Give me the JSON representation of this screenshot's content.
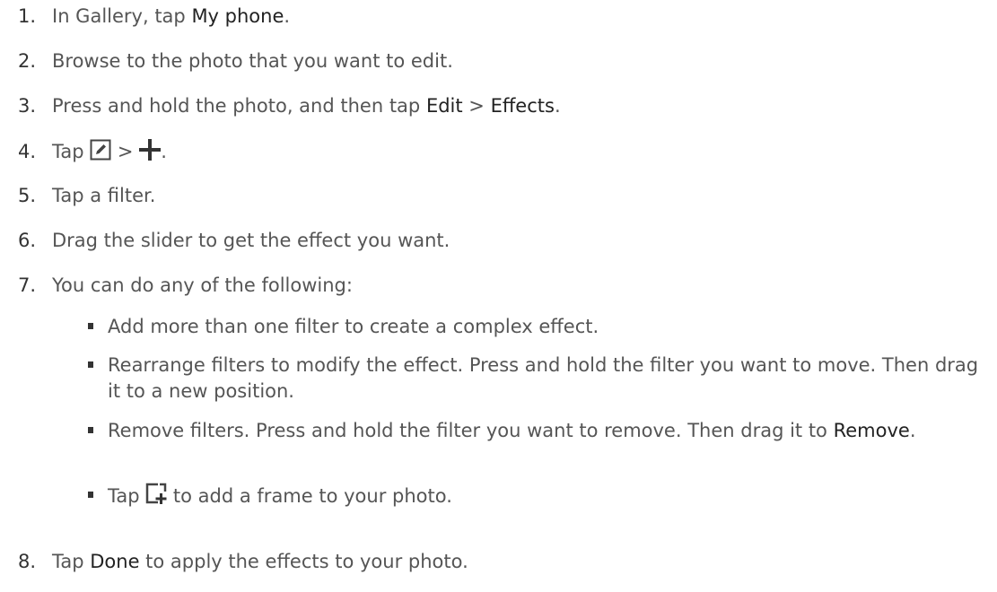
{
  "steps": [
    {
      "num": "1.",
      "pre": "In Gallery, tap ",
      "ui": "My phone",
      "post": "."
    },
    {
      "num": "2.",
      "text": "Browse to the photo that you want to edit."
    },
    {
      "num": "3.",
      "pre": "Press and hold the photo, and then tap ",
      "ui1": "Edit",
      "sep": " > ",
      "ui2": "Effects",
      "post": "."
    },
    {
      "num": "4.",
      "pre": "Tap ",
      "sep": " > ",
      "post": ".",
      "icon1": "edit-pencil-icon",
      "icon2": "plus-icon"
    },
    {
      "num": "5.",
      "text": "Tap a filter."
    },
    {
      "num": "6.",
      "text": "Drag the slider to get the effect you want."
    },
    {
      "num": "7.",
      "text": "You can do any of the following:"
    },
    {
      "num": "8.",
      "pre": "Tap ",
      "ui": "Done",
      "post": " to apply the effects to your photo."
    }
  ],
  "bullets": [
    {
      "text": "Add more than one filter to create a complex effect."
    },
    {
      "text": "Rearrange filters to modify the effect. Press and hold the filter you want to move. Then drag it to a new position."
    },
    {
      "pre": "Remove filters. Press and hold the filter you want to remove. Then drag it to ",
      "ui": "Remove",
      "post": "."
    },
    {
      "pre": "Tap ",
      "post": " to add a frame to your photo.",
      "icon": "add-frame-icon"
    }
  ],
  "colors": {
    "text": "#555555",
    "ui_text": "#222222"
  }
}
